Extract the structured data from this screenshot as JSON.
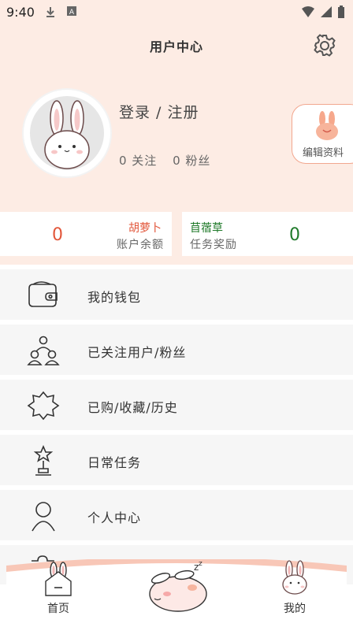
{
  "status": {
    "time": "9:40"
  },
  "header": {
    "title": "用户中心"
  },
  "profile": {
    "login_text": "登录 / 注册",
    "following": "0 关注",
    "fans": "0 粉丝",
    "edit_label": "编辑资料"
  },
  "balance": {
    "left_value": "0",
    "left_name": "胡萝卜",
    "left_sub": "账户余额",
    "right_name": "苜蓿草",
    "right_sub": "任务奖励",
    "right_value": "0"
  },
  "menu": [
    {
      "label": "我的钱包",
      "icon": "wallet-icon"
    },
    {
      "label": "已关注用户/粉丝",
      "icon": "users-icon"
    },
    {
      "label": "已购/收藏/历史",
      "icon": "star-badge-icon"
    },
    {
      "label": "日常任务",
      "icon": "trophy-icon"
    },
    {
      "label": "个人中心",
      "icon": "person-icon"
    }
  ],
  "tabbar": {
    "home": "首页",
    "mine": "我的"
  },
  "colors": {
    "accent": "#f2a78f",
    "carrot": "#e2563a",
    "clover": "#1f7a2a",
    "bg": "#fdece4"
  }
}
